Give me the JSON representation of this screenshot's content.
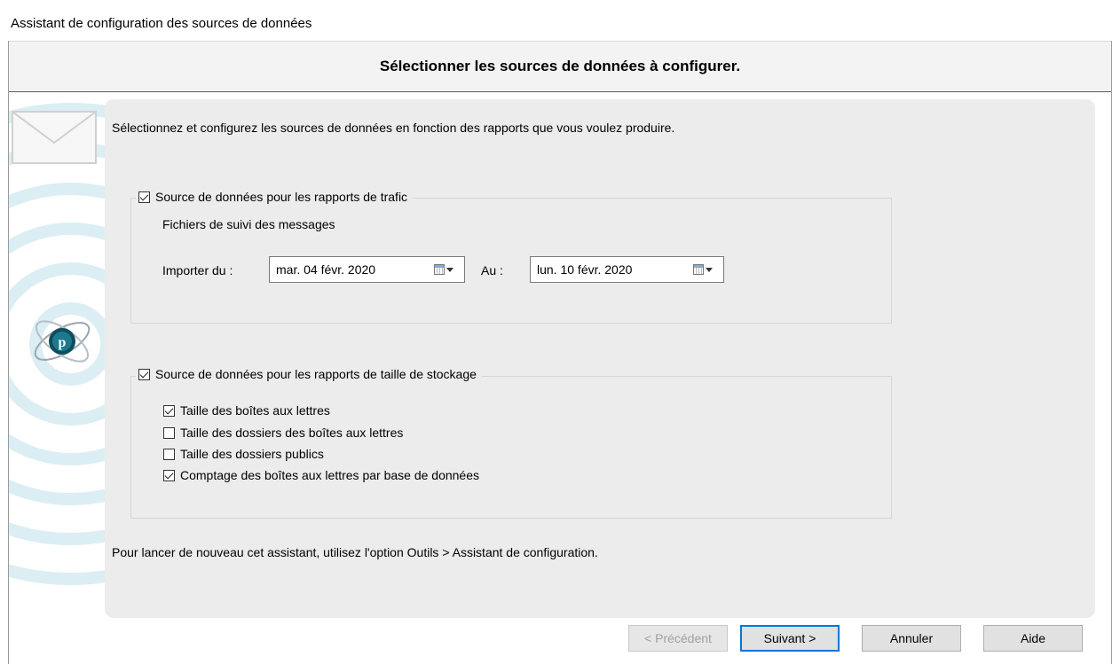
{
  "window": {
    "title": "Assistant de configuration des sources de données"
  },
  "header": {
    "title": "Sélectionner les sources de données à configurer."
  },
  "intro": "Sélectionnez et configurez les sources de données en fonction des rapports que vous voulez produire.",
  "traffic": {
    "checkbox_label": "Source de données pour les rapports de trafic",
    "checked": true,
    "source_label": "Fichiers de suivi des messages",
    "from_label": "Importer du :",
    "from_value": "mar. 04 févr. 2020",
    "to_label": "Au :",
    "to_value": "lun. 10 févr. 2020"
  },
  "storage": {
    "checkbox_label": "Source de données pour les rapports de taille de stockage",
    "checked": true,
    "options": [
      {
        "label": "Taille des boîtes aux lettres",
        "checked": true
      },
      {
        "label": "Taille des dossiers des boîtes aux lettres",
        "checked": false
      },
      {
        "label": "Taille des dossiers publics",
        "checked": false
      },
      {
        "label": "Comptage des boîtes aux lettres par base de données",
        "checked": true
      }
    ]
  },
  "footer_note": "Pour lancer de nouveau cet assistant, utilisez l'option Outils > Assistant de configuration.",
  "buttons": {
    "previous": "< Précédent",
    "next": "Suivant >",
    "cancel": "Annuler",
    "help": "Aide"
  },
  "icons": {
    "envelope": "envelope-icon",
    "logo": "app-logo-icon",
    "calendar": "calendar-icon"
  }
}
